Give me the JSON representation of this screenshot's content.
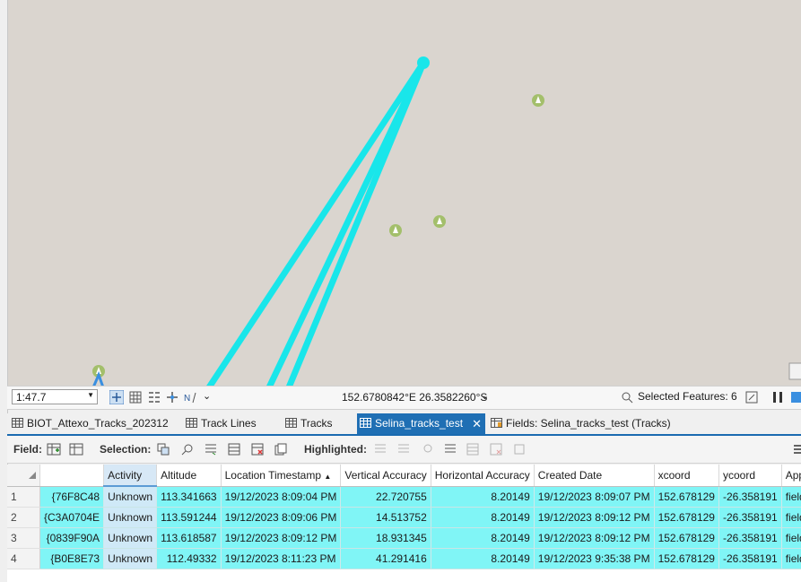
{
  "map": {
    "colors": {
      "background": "#dad5cf",
      "track": "#19e6ea",
      "marker": "#a3bf6b"
    }
  },
  "status": {
    "scale": "1:47.7",
    "coordinates": "152.6780842°E 26.3582260°S",
    "selected_features": "Selected Features: 6"
  },
  "tabs": [
    {
      "label": "BIOT_Attexo_Tracks_202312",
      "icon": "table-icon",
      "active": false
    },
    {
      "label": "Track Lines",
      "icon": "table-icon",
      "active": false
    },
    {
      "label": "Tracks",
      "icon": "table-icon",
      "active": false
    },
    {
      "label": "Selina_tracks_test",
      "icon": "table-icon",
      "active": true
    },
    {
      "label": "Fields: Selina_tracks_test (Tracks)",
      "icon": "fields-icon",
      "active": false
    }
  ],
  "toolbar": {
    "field_label": "Field:",
    "selection_label": "Selection:",
    "highlighted_label": "Highlighted:"
  },
  "table": {
    "columns": [
      "",
      "Activity",
      "Altitude",
      "Location Timestamp",
      "Vertical Accuracy",
      "Horizontal Accuracy",
      "Created Date",
      "xcoord",
      "ycoord",
      "Application ID"
    ],
    "rows": [
      {
        "num": "1",
        "guid": "76F8C48}",
        "activity": "Unknown",
        "altitude": "113.341663",
        "timestamp": "19/12/2023 8:09:04 PM",
        "vacc": "22.720755",
        "hacc": "8.20149",
        "created": "19/12/2023 8:09:07 PM",
        "x": "152.678129",
        "y": "-26.358191",
        "app": "fieldmaps"
      },
      {
        "num": "2",
        "guid": "C3A0704E}",
        "activity": "Unknown",
        "altitude": "113.591244",
        "timestamp": "19/12/2023 8:09:06 PM",
        "vacc": "14.513752",
        "hacc": "8.20149",
        "created": "19/12/2023 8:09:12 PM",
        "x": "152.678129",
        "y": "-26.358191",
        "app": "fieldmaps"
      },
      {
        "num": "3",
        "guid": "0839F90A}",
        "activity": "Unknown",
        "altitude": "113.618587",
        "timestamp": "19/12/2023 8:09:12 PM",
        "vacc": "18.931345",
        "hacc": "8.20149",
        "created": "19/12/2023 8:09:12 PM",
        "x": "152.678129",
        "y": "-26.358191",
        "app": "fieldmaps"
      },
      {
        "num": "4",
        "guid": "B0E8E73}",
        "activity": "Unknown",
        "altitude": "112.49332",
        "timestamp": "19/12/2023 8:11:23 PM",
        "vacc": "41.291416",
        "hacc": "8.20149",
        "created": "19/12/2023 9:35:38 PM",
        "x": "152.678129",
        "y": "-26.358191",
        "app": "fieldmaps"
      }
    ]
  }
}
